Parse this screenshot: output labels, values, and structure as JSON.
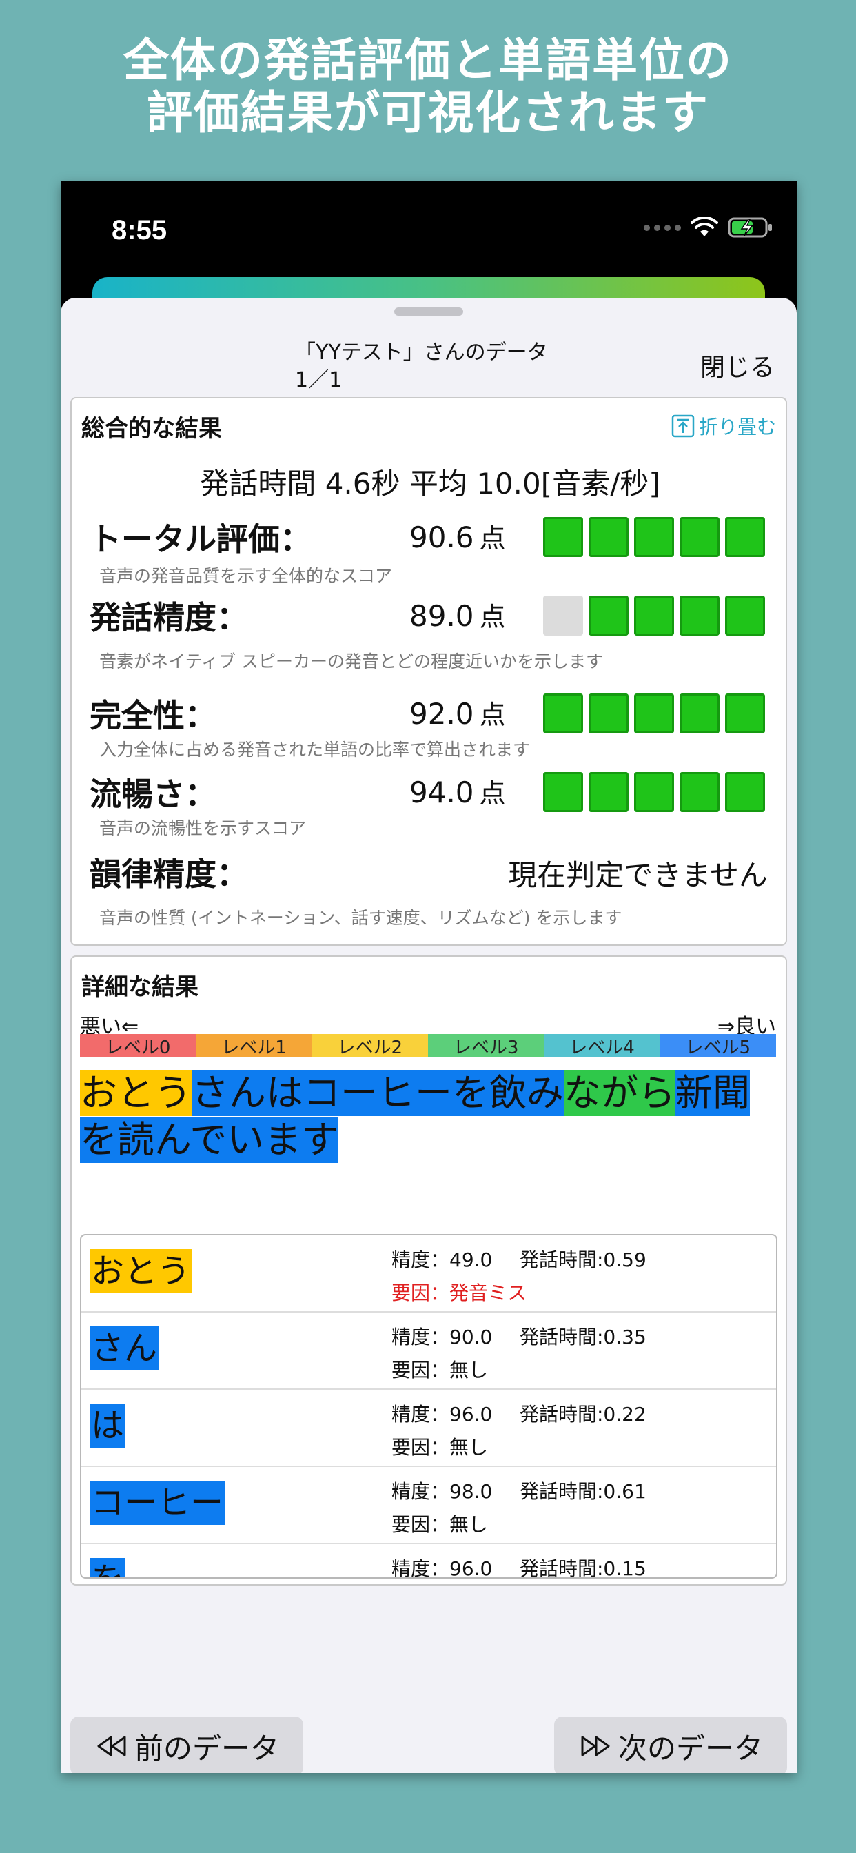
{
  "headline": {
    "line1": "全体の発話評価と単語単位の",
    "line2": "評価結果が可視化されます"
  },
  "status": {
    "time": "8:55"
  },
  "sheet": {
    "title_line1": "「YYテスト」さんのデータ",
    "title_line2": "1／1",
    "close": "閉じる"
  },
  "overall": {
    "heading": "総合的な結果",
    "collapse_label": "折り畳む",
    "summary": "発話時間 4.6秒 平均 10.0[音素/秒]",
    "unit": "点",
    "metrics": [
      {
        "name": "トータル評価：",
        "score": "90.6",
        "level": 5,
        "desc": "音声の発音品質を示す全体的なスコア"
      },
      {
        "name": "発話精度：",
        "score": "89.0",
        "level": 4,
        "desc": "音素がネイティブ スピーカーの発音とどの程度近いかを示します"
      },
      {
        "name": "完全性：",
        "score": "92.0",
        "level": 5,
        "desc": "入力全体に占める発音された単語の比率で算出されます"
      },
      {
        "name": "流暢さ：",
        "score": "94.0",
        "level": 5,
        "desc": "音声の流暢性を示すスコア"
      }
    ],
    "prosody": {
      "name": "韻律精度：",
      "value": "現在判定できません",
      "desc": "音声の性質 (イントネーション、話す速度、リズムなど) を示します"
    }
  },
  "detail": {
    "heading": "詳細な結果",
    "bad_label": "悪い⇐",
    "good_label": "⇒良い",
    "levels": [
      {
        "label": "レベル0",
        "color": "#f26b6b"
      },
      {
        "label": "レベル1",
        "color": "#f5a637"
      },
      {
        "label": "レベル2",
        "color": "#f9d13a"
      },
      {
        "label": "レベル3",
        "color": "#5ccf7a"
      },
      {
        "label": "レベル4",
        "color": "#54c2cf"
      },
      {
        "label": "レベル5",
        "color": "#3b8ef7"
      }
    ],
    "sentence": [
      {
        "text": "おとう",
        "color": "#ffc800"
      },
      {
        "text": "さんはコーヒーを飲み",
        "color": "#0d7cf0"
      },
      {
        "text": "ながら",
        "color": "#2fc84a"
      },
      {
        "text": "新聞",
        "color": "#0d7cf0"
      },
      {
        "text": "を読んでいます",
        "color": "#0d7cf0"
      }
    ],
    "words": [
      {
        "word": "おとう",
        "color": "#ffc800",
        "accuracy": "精度：49.0",
        "time": "発話時間:0.59",
        "reason": "要因：発音ミス",
        "miss": true
      },
      {
        "word": "さん",
        "color": "#0d7cf0",
        "accuracy": "精度：90.0",
        "time": "発話時間:0.35",
        "reason": "要因：無し",
        "miss": false
      },
      {
        "word": "は",
        "color": "#0d7cf0",
        "accuracy": "精度：96.0",
        "time": "発話時間:0.22",
        "reason": "要因：無し",
        "miss": false
      },
      {
        "word": "コーヒー",
        "color": "#0d7cf0",
        "accuracy": "精度：98.0",
        "time": "発話時間:0.61",
        "reason": "要因：無し",
        "miss": false
      },
      {
        "word": "を",
        "color": "#0d7cf0",
        "accuracy": "精度：96.0",
        "time": "発話時間:0.15",
        "reason": "",
        "miss": false
      }
    ]
  },
  "nav": {
    "prev": "前のデータ",
    "next": "次のデータ"
  }
}
